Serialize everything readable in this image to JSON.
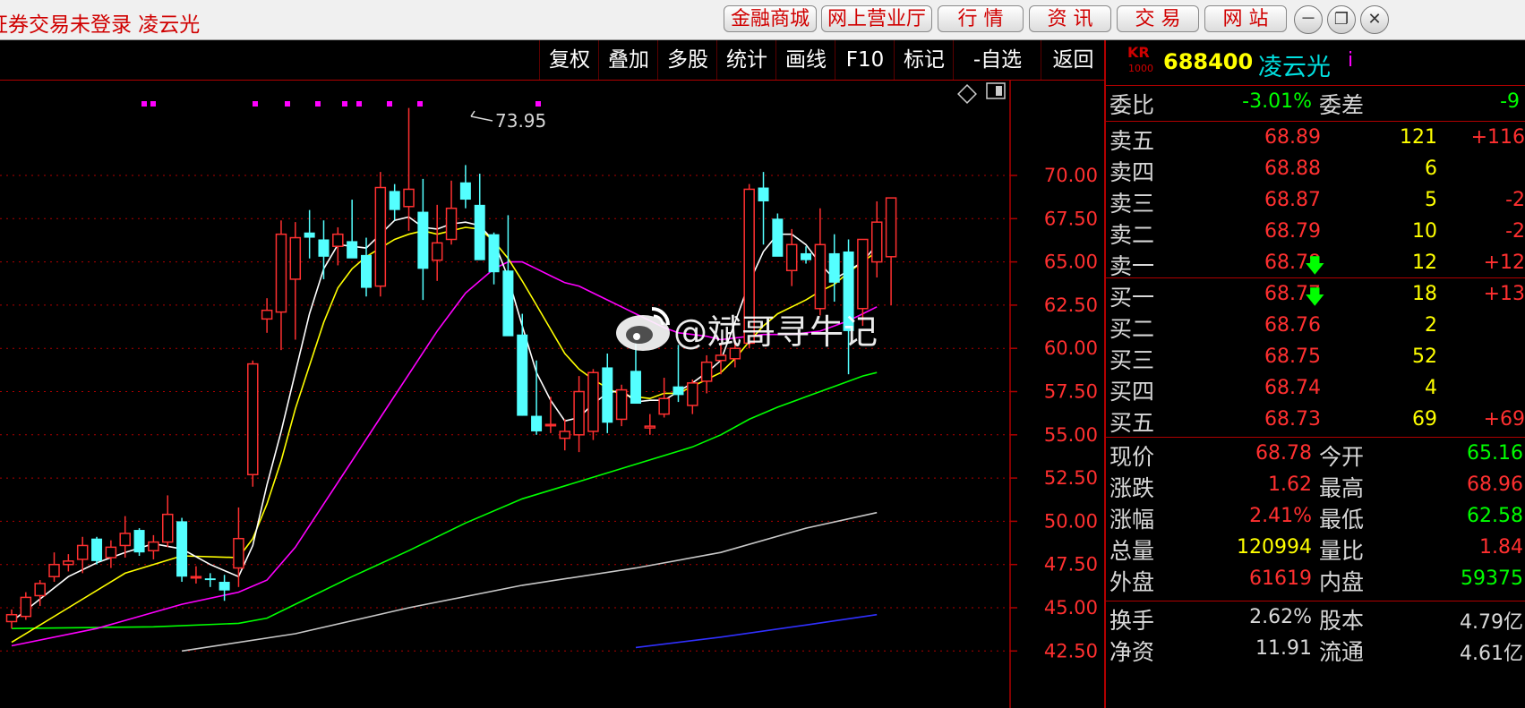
{
  "titlebar": {
    "title": "证券交易未登录  凌云光",
    "buttons": [
      "金融商城",
      "网上营业厅",
      "行 情",
      "资 讯",
      "交 易",
      "网 站"
    ],
    "window_controls": [
      "－",
      "❐",
      "✕"
    ]
  },
  "toolbar": {
    "items": [
      "复权",
      "叠加",
      "多股",
      "统计",
      "画线",
      "F10",
      "标记",
      "-自选",
      "返回"
    ]
  },
  "chart": {
    "price_axis": [
      "70.00",
      "67.50",
      "65.00",
      "62.50",
      "60.00",
      "57.50",
      "55.00",
      "52.50",
      "50.00",
      "47.50",
      "45.00",
      "42.50"
    ],
    "high_label": "73.95",
    "watermark": "@斌哥寻牛记",
    "colors": {
      "up": "#ff3030",
      "down": "#54ffff",
      "ma5": "#ffffff",
      "ma10": "#ffff00",
      "ma20": "#ff00ff",
      "ma60": "#00ff00",
      "ma120": "#c8c8c8",
      "ma250": "#3030ff",
      "grid": "#b00000"
    }
  },
  "chart_data": {
    "type": "candlestick",
    "ylim": [
      42.5,
      75
    ],
    "candles": [
      {
        "o": 44.2,
        "h": 44.9,
        "l": 43.8,
        "c": 44.6
      },
      {
        "o": 44.5,
        "h": 45.9,
        "l": 44.3,
        "c": 45.6
      },
      {
        "o": 45.7,
        "h": 46.6,
        "l": 45.1,
        "c": 46.4
      },
      {
        "o": 46.8,
        "h": 48.2,
        "l": 46.5,
        "c": 47.5
      },
      {
        "o": 47.5,
        "h": 48.1,
        "l": 47.1,
        "c": 47.7
      },
      {
        "o": 47.8,
        "h": 49.1,
        "l": 47.0,
        "c": 48.6
      },
      {
        "o": 49.0,
        "h": 49.1,
        "l": 47.5,
        "c": 47.7
      },
      {
        "o": 47.9,
        "h": 48.9,
        "l": 47.3,
        "c": 48.5
      },
      {
        "o": 48.6,
        "h": 50.3,
        "l": 47.9,
        "c": 49.3
      },
      {
        "o": 49.5,
        "h": 49.6,
        "l": 48.0,
        "c": 48.2
      },
      {
        "o": 48.3,
        "h": 49.2,
        "l": 47.8,
        "c": 48.8
      },
      {
        "o": 48.8,
        "h": 51.5,
        "l": 48.5,
        "c": 50.4
      },
      {
        "o": 50.0,
        "h": 50.2,
        "l": 46.5,
        "c": 46.8
      },
      {
        "o": 46.8,
        "h": 47.4,
        "l": 46.4,
        "c": 46.8
      },
      {
        "o": 46.7,
        "h": 47.0,
        "l": 46.2,
        "c": 46.6
      },
      {
        "o": 46.5,
        "h": 46.9,
        "l": 45.4,
        "c": 46.0
      },
      {
        "o": 47.3,
        "h": 50.8,
        "l": 46.2,
        "c": 49.0
      },
      {
        "o": 52.7,
        "h": 59.3,
        "l": 52.0,
        "c": 59.1
      },
      {
        "o": 61.7,
        "h": 62.9,
        "l": 60.9,
        "c": 62.2
      },
      {
        "o": 62.1,
        "h": 67.4,
        "l": 59.9,
        "c": 66.6
      },
      {
        "o": 64.0,
        "h": 67.3,
        "l": 60.5,
        "c": 66.4
      },
      {
        "o": 66.7,
        "h": 68.0,
        "l": 65.2,
        "c": 66.4
      },
      {
        "o": 66.3,
        "h": 67.4,
        "l": 64.0,
        "c": 65.3
      },
      {
        "o": 65.9,
        "h": 67.0,
        "l": 64.8,
        "c": 66.6
      },
      {
        "o": 66.2,
        "h": 68.6,
        "l": 65.4,
        "c": 65.2
      },
      {
        "o": 65.4,
        "h": 66.4,
        "l": 63.0,
        "c": 63.5
      },
      {
        "o": 63.6,
        "h": 70.2,
        "l": 63.0,
        "c": 69.3
      },
      {
        "o": 69.1,
        "h": 69.5,
        "l": 67.4,
        "c": 68.0
      },
      {
        "o": 68.2,
        "h": 73.9,
        "l": 66.8,
        "c": 69.2
      },
      {
        "o": 67.9,
        "h": 69.8,
        "l": 62.8,
        "c": 64.6
      },
      {
        "o": 65.1,
        "h": 68.3,
        "l": 63.9,
        "c": 66.1
      },
      {
        "o": 66.3,
        "h": 69.7,
        "l": 66.0,
        "c": 68.1
      },
      {
        "o": 69.6,
        "h": 70.6,
        "l": 68.1,
        "c": 68.6
      },
      {
        "o": 68.3,
        "h": 70.1,
        "l": 65.4,
        "c": 65.1
      },
      {
        "o": 66.6,
        "h": 66.7,
        "l": 63.7,
        "c": 64.4
      },
      {
        "o": 64.5,
        "h": 67.7,
        "l": 61.3,
        "c": 60.7
      },
      {
        "o": 60.8,
        "h": 62.0,
        "l": 56.1,
        "c": 56.1
      },
      {
        "o": 56.1,
        "h": 59.3,
        "l": 55.0,
        "c": 55.2
      },
      {
        "o": 55.6,
        "h": 57.2,
        "l": 55.1,
        "c": 55.6
      },
      {
        "o": 54.8,
        "h": 55.9,
        "l": 54.1,
        "c": 55.2
      },
      {
        "o": 55.0,
        "h": 58.4,
        "l": 54.0,
        "c": 57.5
      },
      {
        "o": 55.2,
        "h": 58.8,
        "l": 54.7,
        "c": 58.6
      },
      {
        "o": 58.9,
        "h": 59.7,
        "l": 55.1,
        "c": 55.7
      },
      {
        "o": 55.9,
        "h": 57.9,
        "l": 55.5,
        "c": 57.6
      },
      {
        "o": 58.7,
        "h": 60.9,
        "l": 57.6,
        "c": 56.8
      },
      {
        "o": 55.4,
        "h": 56.2,
        "l": 55.0,
        "c": 55.5
      },
      {
        "o": 56.2,
        "h": 58.3,
        "l": 56.0,
        "c": 57.1
      },
      {
        "o": 57.8,
        "h": 60.2,
        "l": 56.9,
        "c": 57.3
      },
      {
        "o": 56.7,
        "h": 58.2,
        "l": 56.2,
        "c": 58.0
      },
      {
        "o": 58.1,
        "h": 59.6,
        "l": 57.4,
        "c": 59.2
      },
      {
        "o": 59.3,
        "h": 60.3,
        "l": 58.5,
        "c": 59.6
      },
      {
        "o": 59.4,
        "h": 60.6,
        "l": 58.9,
        "c": 60.0
      },
      {
        "o": 60.3,
        "h": 69.5,
        "l": 60.0,
        "c": 69.2
      },
      {
        "o": 69.3,
        "h": 70.2,
        "l": 66.0,
        "c": 68.5
      },
      {
        "o": 67.5,
        "h": 67.8,
        "l": 65.4,
        "c": 65.3
      },
      {
        "o": 64.5,
        "h": 66.9,
        "l": 63.6,
        "c": 66.0
      },
      {
        "o": 65.5,
        "h": 65.9,
        "l": 64.9,
        "c": 65.1
      },
      {
        "o": 62.3,
        "h": 68.1,
        "l": 61.9,
        "c": 66.0
      },
      {
        "o": 65.5,
        "h": 66.6,
        "l": 62.7,
        "c": 63.8
      },
      {
        "o": 65.6,
        "h": 66.3,
        "l": 58.5,
        "c": 61.0
      },
      {
        "o": 62.3,
        "h": 66.2,
        "l": 61.3,
        "c": 66.3
      },
      {
        "o": 65.0,
        "h": 68.5,
        "l": 64.1,
        "c": 67.3
      },
      {
        "o": 65.3,
        "h": 68.6,
        "l": 62.5,
        "c": 68.7
      }
    ],
    "ma5": [
      [
        0,
        44.2
      ],
      [
        2,
        45.5
      ],
      [
        4,
        46.8
      ],
      [
        6,
        47.6
      ],
      [
        8,
        48.2
      ],
      [
        10,
        48.7
      ],
      [
        12,
        48.4
      ],
      [
        14,
        47.5
      ],
      [
        16,
        46.8
      ],
      [
        17,
        48.6
      ],
      [
        18,
        52.1
      ],
      [
        19,
        55.2
      ],
      [
        20,
        58.6
      ],
      [
        21,
        62.0
      ],
      [
        22,
        64.6
      ],
      [
        23,
        66.0
      ],
      [
        24,
        65.9
      ],
      [
        25,
        65.8
      ],
      [
        26,
        66.6
      ],
      [
        27,
        67.4
      ],
      [
        28,
        67.6
      ],
      [
        29,
        67.0
      ],
      [
        30,
        66.9
      ],
      [
        31,
        67.2
      ],
      [
        32,
        67.3
      ],
      [
        33,
        67.1
      ],
      [
        34,
        66.2
      ],
      [
        35,
        64.1
      ],
      [
        36,
        61.3
      ],
      [
        37,
        58.6
      ],
      [
        38,
        57.0
      ],
      [
        39,
        55.8
      ],
      [
        40,
        56.0
      ],
      [
        41,
        56.8
      ],
      [
        42,
        57.4
      ],
      [
        43,
        57.6
      ],
      [
        44,
        56.9
      ],
      [
        45,
        57.0
      ],
      [
        46,
        57.0
      ],
      [
        47,
        57.5
      ],
      [
        48,
        58.0
      ],
      [
        49,
        58.6
      ],
      [
        50,
        59.3
      ],
      [
        51,
        61.5
      ],
      [
        52,
        63.8
      ],
      [
        53,
        65.6
      ],
      [
        54,
        66.6
      ],
      [
        55,
        66.6
      ],
      [
        56,
        66.0
      ],
      [
        57,
        64.9
      ],
      [
        58,
        64.0
      ],
      [
        59,
        64.5
      ],
      [
        60,
        65.0
      ],
      [
        61,
        66.0
      ]
    ],
    "ma10": [
      [
        0,
        43.0
      ],
      [
        4,
        45.0
      ],
      [
        8,
        47.0
      ],
      [
        12,
        48.0
      ],
      [
        16,
        47.9
      ],
      [
        17,
        49.0
      ],
      [
        18,
        51.0
      ],
      [
        19,
        53.5
      ],
      [
        20,
        56.5
      ],
      [
        21,
        59.0
      ],
      [
        22,
        61.5
      ],
      [
        23,
        63.5
      ],
      [
        24,
        64.6
      ],
      [
        25,
        65.3
      ],
      [
        26,
        65.8
      ],
      [
        27,
        66.3
      ],
      [
        28,
        66.6
      ],
      [
        29,
        66.8
      ],
      [
        30,
        66.6
      ],
      [
        31,
        66.8
      ],
      [
        32,
        67.0
      ],
      [
        33,
        66.9
      ],
      [
        34,
        66.2
      ],
      [
        35,
        65.2
      ],
      [
        36,
        63.9
      ],
      [
        37,
        62.5
      ],
      [
        38,
        61.1
      ],
      [
        39,
        59.7
      ],
      [
        40,
        58.8
      ],
      [
        41,
        58.2
      ],
      [
        42,
        57.7
      ],
      [
        43,
        57.3
      ],
      [
        44,
        57.2
      ],
      [
        45,
        57.1
      ],
      [
        46,
        57.4
      ],
      [
        47,
        57.4
      ],
      [
        48,
        57.8
      ],
      [
        49,
        58.2
      ],
      [
        50,
        58.6
      ],
      [
        51,
        59.4
      ],
      [
        52,
        60.4
      ],
      [
        53,
        61.3
      ],
      [
        54,
        62.0
      ],
      [
        55,
        62.4
      ],
      [
        56,
        62.8
      ],
      [
        57,
        63.3
      ],
      [
        58,
        63.7
      ],
      [
        59,
        64.4
      ],
      [
        60,
        65.0
      ],
      [
        61,
        65.6
      ]
    ],
    "ma20": [
      [
        0,
        42.8
      ],
      [
        6,
        43.8
      ],
      [
        12,
        45.2
      ],
      [
        16,
        45.9
      ],
      [
        18,
        46.6
      ],
      [
        20,
        48.5
      ],
      [
        22,
        51.0
      ],
      [
        24,
        53.5
      ],
      [
        26,
        56.0
      ],
      [
        28,
        58.5
      ],
      [
        30,
        61.0
      ],
      [
        32,
        63.2
      ],
      [
        34,
        64.6
      ],
      [
        35,
        65.0
      ],
      [
        36,
        65.0
      ],
      [
        37,
        64.6
      ],
      [
        38,
        64.2
      ],
      [
        39,
        63.8
      ],
      [
        40,
        63.6
      ],
      [
        41,
        63.2
      ],
      [
        42,
        62.8
      ],
      [
        43,
        62.4
      ],
      [
        44,
        62.0
      ],
      [
        45,
        61.6
      ],
      [
        46,
        61.2
      ],
      [
        47,
        60.9
      ],
      [
        48,
        60.8
      ],
      [
        49,
        60.7
      ],
      [
        50,
        60.5
      ],
      [
        51,
        60.6
      ],
      [
        52,
        60.7
      ],
      [
        53,
        60.8
      ],
      [
        54,
        60.8
      ],
      [
        55,
        60.8
      ],
      [
        56,
        60.9
      ],
      [
        57,
        61.0
      ],
      [
        58,
        61.3
      ],
      [
        59,
        61.6
      ],
      [
        60,
        62.0
      ],
      [
        61,
        62.4
      ]
    ],
    "ma60": [
      [
        0,
        43.8
      ],
      [
        10,
        43.9
      ],
      [
        16,
        44.1
      ],
      [
        18,
        44.4
      ],
      [
        20,
        45.2
      ],
      [
        24,
        46.8
      ],
      [
        28,
        48.3
      ],
      [
        32,
        49.9
      ],
      [
        36,
        51.3
      ],
      [
        40,
        52.3
      ],
      [
        44,
        53.3
      ],
      [
        48,
        54.3
      ],
      [
        50,
        55.0
      ],
      [
        52,
        55.9
      ],
      [
        54,
        56.6
      ],
      [
        56,
        57.2
      ],
      [
        58,
        57.8
      ],
      [
        60,
        58.4
      ],
      [
        61,
        58.6
      ]
    ],
    "ma120": [
      [
        12,
        42.5
      ],
      [
        20,
        43.5
      ],
      [
        28,
        45.0
      ],
      [
        36,
        46.3
      ],
      [
        44,
        47.3
      ],
      [
        50,
        48.2
      ],
      [
        56,
        49.6
      ],
      [
        61,
        50.5
      ]
    ],
    "ma250": [
      [
        44,
        42.7
      ],
      [
        50,
        43.3
      ],
      [
        56,
        44.0
      ],
      [
        61,
        44.6
      ]
    ]
  },
  "panel": {
    "kr": "KR",
    "kr_sub": "1000",
    "code": "688400",
    "name": "凌云光",
    "info": "i",
    "weibi": {
      "label": "委比",
      "value": "-3.01%",
      "label2": "委差",
      "value2": "-9"
    },
    "asks": [
      {
        "label": "卖五",
        "price": "68.89",
        "vol": "121",
        "chg": "+116",
        "arrow": ""
      },
      {
        "label": "卖四",
        "price": "68.88",
        "vol": "6",
        "chg": "",
        "arrow": ""
      },
      {
        "label": "卖三",
        "price": "68.87",
        "vol": "5",
        "chg": "-2",
        "arrow": ""
      },
      {
        "label": "卖二",
        "price": "68.79",
        "vol": "10",
        "chg": "-2",
        "arrow": ""
      },
      {
        "label": "卖一",
        "price": "68.78",
        "vol": "12",
        "chg": "+12",
        "arrow": "🡇"
      }
    ],
    "bids": [
      {
        "label": "买一",
        "price": "68.77",
        "vol": "18",
        "chg": "+13",
        "arrow": "🡇"
      },
      {
        "label": "买二",
        "price": "68.76",
        "vol": "2",
        "chg": "",
        "arrow": ""
      },
      {
        "label": "买三",
        "price": "68.75",
        "vol": "52",
        "chg": "",
        "arrow": ""
      },
      {
        "label": "买四",
        "price": "68.74",
        "vol": "4",
        "chg": "",
        "arrow": ""
      },
      {
        "label": "买五",
        "price": "68.73",
        "vol": "69",
        "chg": "+69",
        "arrow": ""
      }
    ],
    "stats": [
      {
        "l1": "现价",
        "v1": "68.78",
        "c1": "#ff3030",
        "l2": "今开",
        "v2": "65.16",
        "c2": "#00ff00"
      },
      {
        "l1": "涨跌",
        "v1": "1.62",
        "c1": "#ff3030",
        "l2": "最高",
        "v2": "68.96",
        "c2": "#ff3030"
      },
      {
        "l1": "涨幅",
        "v1": "2.41%",
        "c1": "#ff3030",
        "l2": "最低",
        "v2": "62.58",
        "c2": "#00ff00"
      },
      {
        "l1": "总量",
        "v1": "120994",
        "c1": "#ffff00",
        "l2": "量比",
        "v2": "1.84",
        "c2": "#ff3030"
      },
      {
        "l1": "外盘",
        "v1": "61619",
        "c1": "#ff3030",
        "l2": "内盘",
        "v2": "59375",
        "c2": "#00ff00"
      }
    ],
    "stats2": [
      {
        "l1": "换手",
        "v1": "2.62%",
        "c1": "#d8d8d8",
        "l2": "股本",
        "v2": "4.79亿",
        "c2": "#d8d8d8"
      },
      {
        "l1": "净资",
        "v1": "11.91",
        "c1": "#d8d8d8",
        "l2": "流通",
        "v2": "4.61亿",
        "c2": "#d8d8d8"
      }
    ]
  }
}
